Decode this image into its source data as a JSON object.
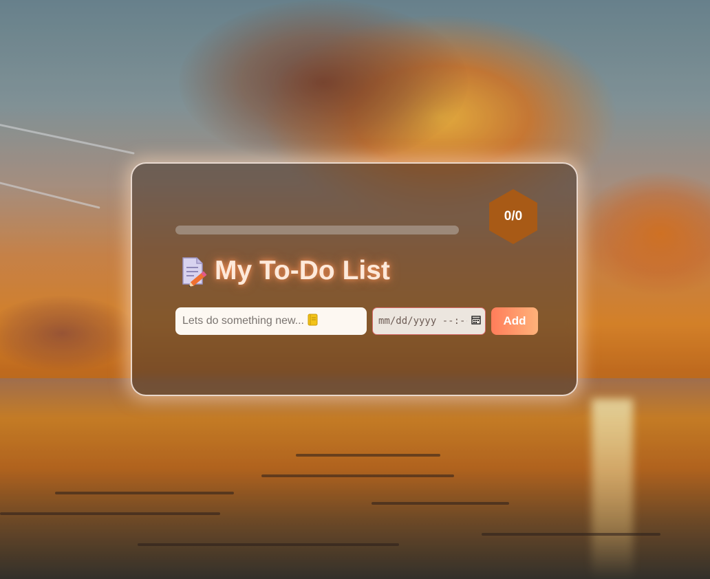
{
  "progress": {
    "fraction": 0,
    "counter": "0/0"
  },
  "header": {
    "title": "My To-Do List",
    "title_icon": "memo-icon"
  },
  "form": {
    "task_placeholder": "Lets do something new...",
    "task_placeholder_icon": "notebook-icon",
    "date_placeholder": "mm/dd/yyyy --:-- --",
    "date_icon": "calendar-icon",
    "add_label": "Add"
  },
  "colors": {
    "accent": "#ff8a5c",
    "badge": "#a85a16",
    "title_glow": "#ff9a5a"
  }
}
